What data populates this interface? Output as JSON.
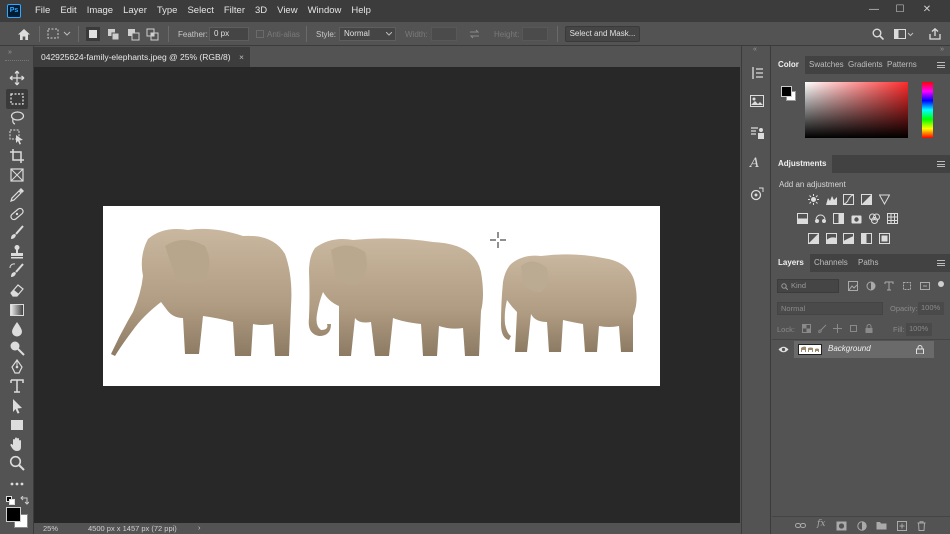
{
  "app": {
    "logo_text": "Ps"
  },
  "menu": {
    "items": [
      "File",
      "Edit",
      "Image",
      "Layer",
      "Type",
      "Select",
      "Filter",
      "3D",
      "View",
      "Window",
      "Help"
    ]
  },
  "window_controls": {
    "minimize": "—",
    "maximize": "☐",
    "close": "✕"
  },
  "options": {
    "feather_label": "Feather:",
    "feather_value": "0 px",
    "antialias_label": "Anti-alias",
    "style_label": "Style:",
    "style_value": "Normal",
    "width_label": "Width:",
    "height_label": "Height:",
    "select_mask_label": "Select and Mask..."
  },
  "document": {
    "tab_title": "042925624-family-elephants.jpeg @ 25% (RGB/8)",
    "tab_close": "×"
  },
  "status": {
    "zoom": "25%",
    "dimensions": "4500 px x 1457 px (72 ppi)",
    "arrow": "›"
  },
  "color_panel": {
    "tabs": [
      "Color",
      "Swatches",
      "Gradients",
      "Patterns"
    ],
    "foreground": "#000000",
    "background": "#ffffff"
  },
  "adjustments_panel": {
    "tab": "Adjustments",
    "hint": "Add an adjustment"
  },
  "layers_panel": {
    "tabs": [
      "Layers",
      "Channels",
      "Paths"
    ],
    "kind_placeholder": "Kind",
    "blend_mode": "Normal",
    "opacity_label": "Opacity:",
    "opacity_value": "100%",
    "lock_label": "Lock:",
    "fill_label": "Fill:",
    "fill_value": "100%",
    "layers": [
      {
        "name": "Background",
        "visible": true,
        "locked": true
      }
    ]
  },
  "icons": {
    "tools": [
      "move-icon",
      "marquee-icon",
      "lasso-icon",
      "object-select-icon",
      "crop-icon",
      "frame-icon",
      "eyedropper-icon",
      "healing-brush-icon",
      "brush-icon",
      "stamp-icon",
      "history-brush-icon",
      "eraser-icon",
      "gradient-icon",
      "blur-icon",
      "dodge-icon",
      "pen-icon",
      "type-icon",
      "path-select-icon",
      "rectangle-icon",
      "hand-icon",
      "zoom-icon",
      "more-icon"
    ]
  }
}
